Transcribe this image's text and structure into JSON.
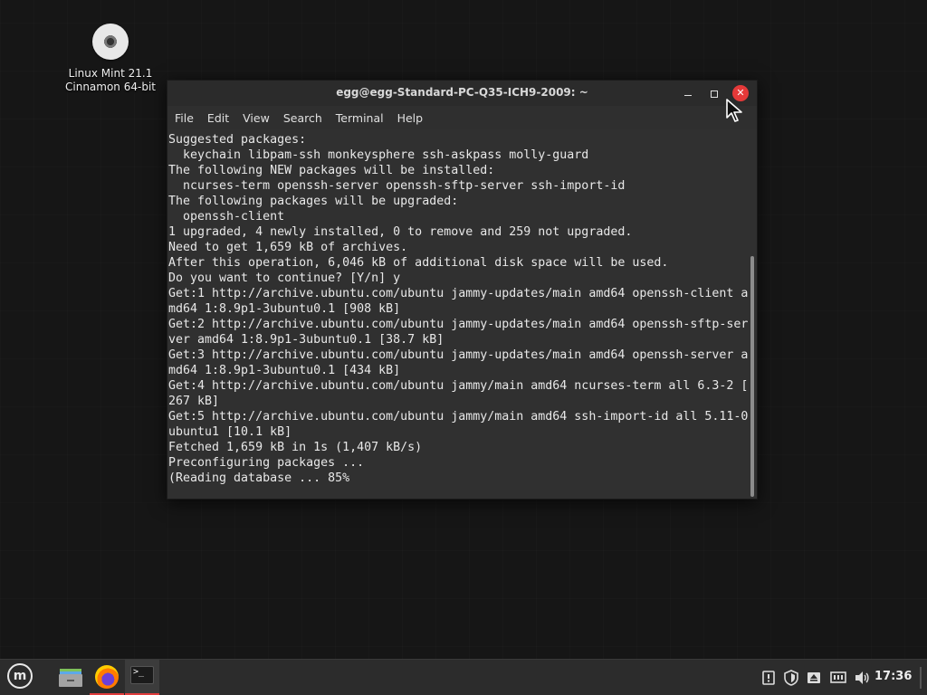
{
  "desktop": {
    "icon_line1": "Linux Mint 21.1",
    "icon_line2": "Cinnamon 64-bit"
  },
  "window": {
    "title": "egg@egg-Standard-PC-Q35-ICH9-2009: ~",
    "menu": [
      "File",
      "Edit",
      "View",
      "Search",
      "Terminal",
      "Help"
    ]
  },
  "terminal": {
    "output": "Suggested packages:\n  keychain libpam-ssh monkeysphere ssh-askpass molly-guard\nThe following NEW packages will be installed:\n  ncurses-term openssh-server openssh-sftp-server ssh-import-id\nThe following packages will be upgraded:\n  openssh-client\n1 upgraded, 4 newly installed, 0 to remove and 259 not upgraded.\nNeed to get 1,659 kB of archives.\nAfter this operation, 6,046 kB of additional disk space will be used.\nDo you want to continue? [Y/n] y\nGet:1 http://archive.ubuntu.com/ubuntu jammy-updates/main amd64 openssh-client a\nmd64 1:8.9p1-3ubuntu0.1 [908 kB]\nGet:2 http://archive.ubuntu.com/ubuntu jammy-updates/main amd64 openssh-sftp-ser\nver amd64 1:8.9p1-3ubuntu0.1 [38.7 kB]\nGet:3 http://archive.ubuntu.com/ubuntu jammy-updates/main amd64 openssh-server a\nmd64 1:8.9p1-3ubuntu0.1 [434 kB]\nGet:4 http://archive.ubuntu.com/ubuntu jammy/main amd64 ncurses-term all 6.3-2 [\n267 kB]\nGet:5 http://archive.ubuntu.com/ubuntu jammy/main amd64 ssh-import-id all 5.11-0\nubuntu1 [10.1 kB]\nFetched 1,659 kB in 1s (1,407 kB/s)\nPreconfiguring packages ...\n(Reading database ... 85%"
  },
  "taskbar": {
    "clock": "17:36",
    "accent_color": "#e03c3c"
  },
  "colors": {
    "close_button": "#e53939",
    "terminal_bg": "#303030",
    "terminal_fg": "#e8e8e8"
  }
}
